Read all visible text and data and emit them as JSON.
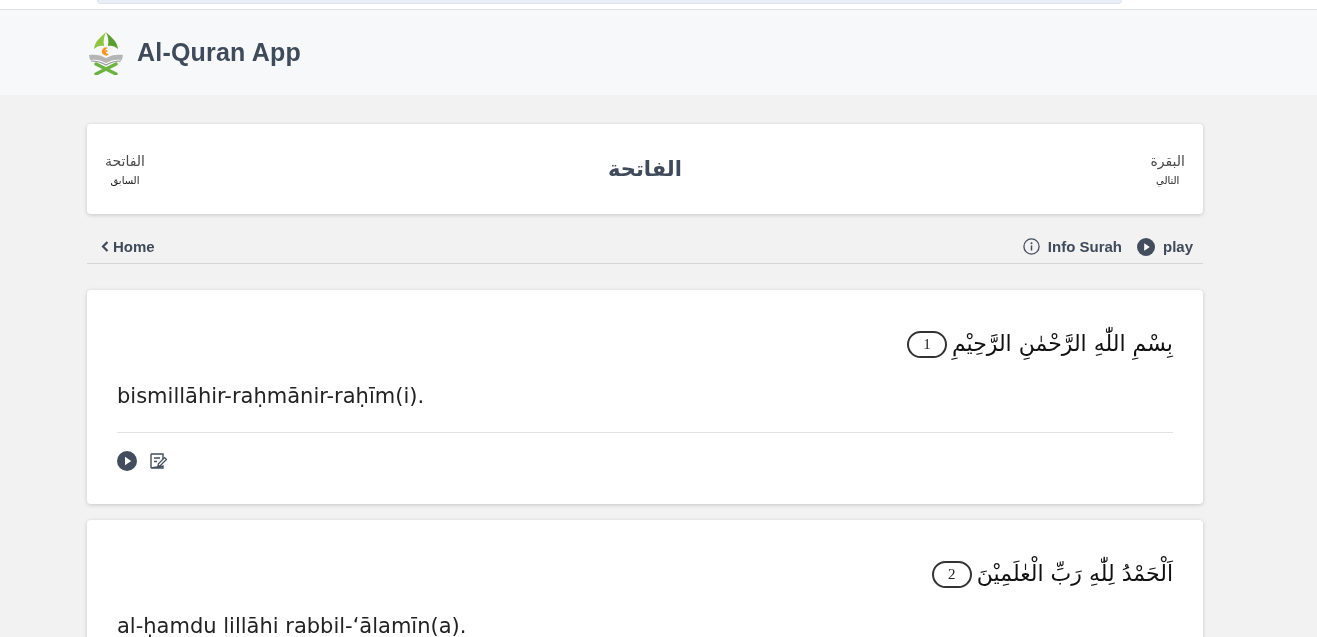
{
  "header": {
    "title": "Al-Quran App"
  },
  "surah_nav": {
    "previous": {
      "name": "الفاتحة",
      "label": "السابق"
    },
    "current": "الفاتحة",
    "next": {
      "name": "البقرة",
      "label": "التالي"
    }
  },
  "toolbar": {
    "back": "Home",
    "info": "Info Surah",
    "play": "play"
  },
  "verses": [
    {
      "number": "1",
      "arabic": "بِسْمِ اللّٰهِ الرَّحْمٰنِ الرَّحِيْمِ",
      "transliteration": "bismillāhir-raḥmānir-raḥīm(i)."
    },
    {
      "number": "2",
      "arabic": "اَلْحَمْدُ لِلّٰهِ رَبِّ الْعٰلَمِيْنَ",
      "transliteration": "al-ḥamdu lillāhi rabbil-‘ālamīn(a)."
    }
  ]
}
